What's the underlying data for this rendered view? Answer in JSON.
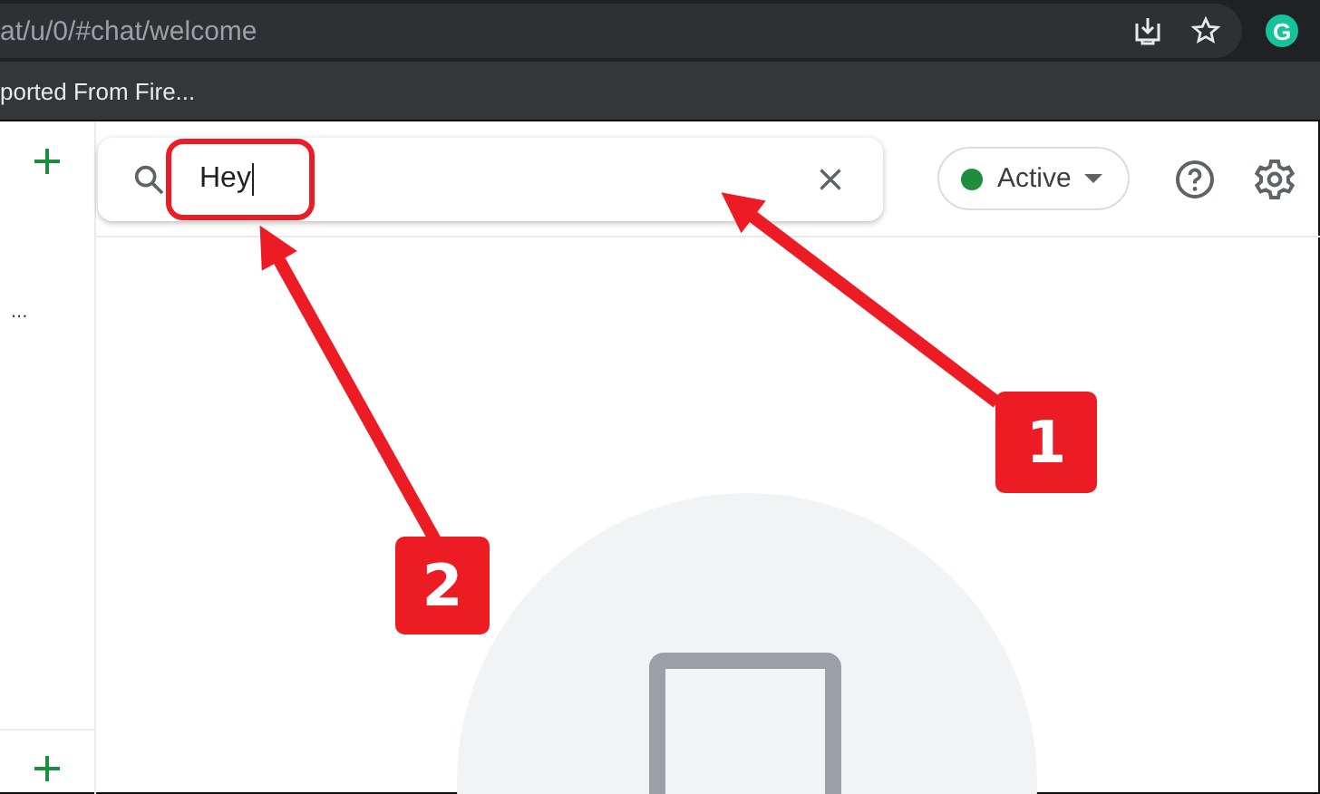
{
  "browser": {
    "url": "at/u/0/#chat/welcome",
    "bookmarks": [
      "ported From Fire..."
    ],
    "profile_initial": "G"
  },
  "search": {
    "value": "Hey"
  },
  "status": {
    "label": "Active",
    "color": "#1e8e3e"
  },
  "sidebar": {
    "items": [
      {
        "kind": "add"
      },
      {
        "kind": "more",
        "label": "..."
      },
      {
        "kind": "add"
      }
    ]
  },
  "annotations": [
    {
      "label": "1"
    },
    {
      "label": "2"
    }
  ]
}
